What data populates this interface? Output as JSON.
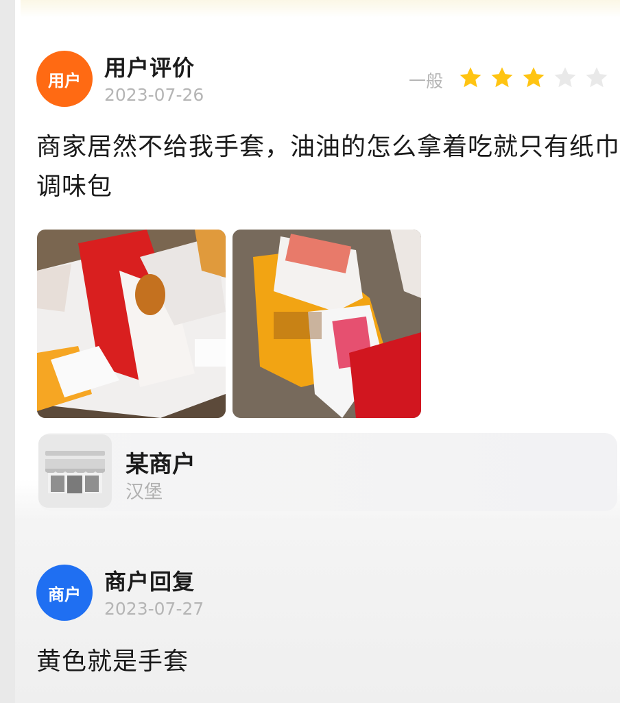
{
  "review": {
    "avatar_label": "用户",
    "title": "用户评价",
    "date": "2023-07-26",
    "rating_label": "一般",
    "rating": 3,
    "max_rating": 5,
    "text": "商家居然不给我手套，油油的怎么拿着吃就只有纸巾调味包",
    "photos": [
      "sauce-packets-photo",
      "condiment-packets-photo"
    ]
  },
  "merchant": {
    "name": "某商户",
    "category": "汉堡",
    "icon": "storefront-icon"
  },
  "reply": {
    "avatar_label": "商户",
    "title": "商户回复",
    "date": "2023-07-27",
    "text": "黄色就是手套"
  },
  "colors": {
    "user_avatar": "#ff6a13",
    "merchant_avatar": "#1f6ff2",
    "star_filled": "#ffc412",
    "star_empty": "#e9e9e9"
  }
}
